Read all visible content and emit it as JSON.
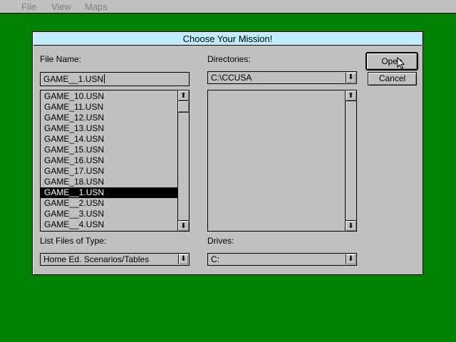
{
  "menubar": {
    "items": [
      "File",
      "View",
      "Maps"
    ]
  },
  "dialog": {
    "title": "Choose Your Mission!",
    "file_name": {
      "label": "File Name:",
      "value": "GAME__1.USN",
      "files": [
        "GAME_10.USN",
        "GAME_11.USN",
        "GAME_12.USN",
        "GAME_13.USN",
        "GAME_14.USN",
        "GAME_15.USN",
        "GAME_16.USN",
        "GAME_17.USN",
        "GAME_18.USN",
        "GAME__1.USN",
        "GAME__2.USN",
        "GAME__3.USN",
        "GAME__4.USN"
      ],
      "selected_file": "GAME__1.USN"
    },
    "directories": {
      "label": "Directories:",
      "value": "C:\\CCUSA",
      "items": []
    },
    "file_type": {
      "label": "List Files of Type:",
      "value": "Home Ed. Scenarios/Tables"
    },
    "drives": {
      "label": "Drives:",
      "value": "C:"
    },
    "buttons": {
      "open": "Open",
      "cancel": "Cancel"
    }
  },
  "icons": {
    "dropdown": "down-arrow-icon",
    "scroll_up": "up-arrow-icon",
    "scroll_down": "down-arrow-icon",
    "pointer": "mouse-pointer-icon"
  },
  "colors": {
    "desktop": "#008000",
    "dialog_bg": "#c0c0c0",
    "titlebar": "#bfefff",
    "selection": "#000000",
    "menu_disabled_text": "#808080"
  }
}
